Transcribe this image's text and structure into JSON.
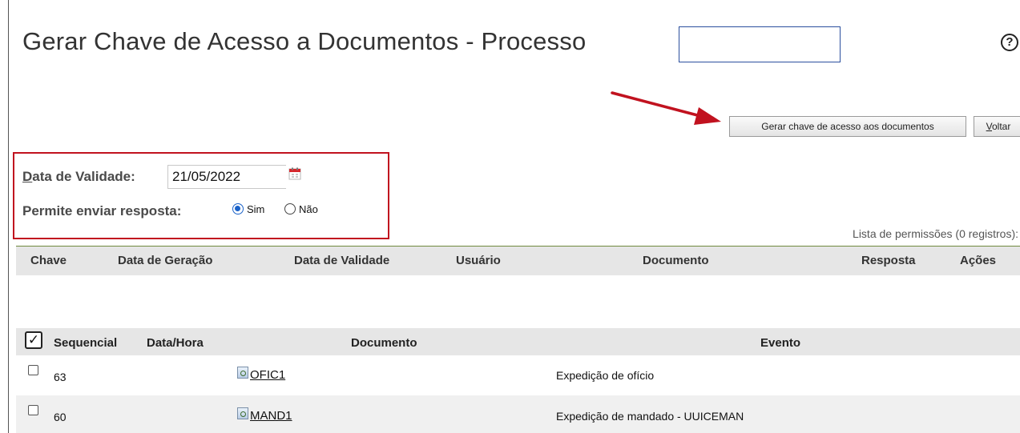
{
  "header": {
    "title": "Gerar Chave de Acesso a Documentos - Processo",
    "process_value": "",
    "help_icon": "help-circle-icon"
  },
  "toolbar": {
    "gerar_label": "Gerar chave de acesso aos documentos",
    "voltar_first": "V",
    "voltar_rest": "oltar"
  },
  "form": {
    "validade_first": "D",
    "validade_rest": "ata de Validade:",
    "validade_value": "21/05/2022",
    "calendar_icon": "calendar-icon",
    "resposta_label": "Permite enviar resposta:",
    "option_sim": "Sim",
    "option_nao": "Não",
    "selected": "Sim"
  },
  "permissions": {
    "caption": "Lista de permissões (0 registros):",
    "columns": [
      "Chave",
      "Data de Geração",
      "Data de Validade",
      "Usuário",
      "Documento",
      "Resposta",
      "Ações"
    ]
  },
  "documents": {
    "columns": [
      "Sequencial",
      "Data/Hora",
      "Documento",
      "Evento"
    ],
    "rows": [
      {
        "sequencial": "63",
        "data_hora": "",
        "documento": "OFIC1",
        "evento": "Expedição de ofício"
      },
      {
        "sequencial": "60",
        "data_hora": "",
        "documento": "MAND1",
        "evento": "Expedição de mandado - UUICEMAN"
      }
    ]
  },
  "colors": {
    "highlight_box": "#c1121f",
    "arrow": "#c1121f",
    "radio_selected": "#1a62c9",
    "header_rule": "#6f8a3e"
  }
}
